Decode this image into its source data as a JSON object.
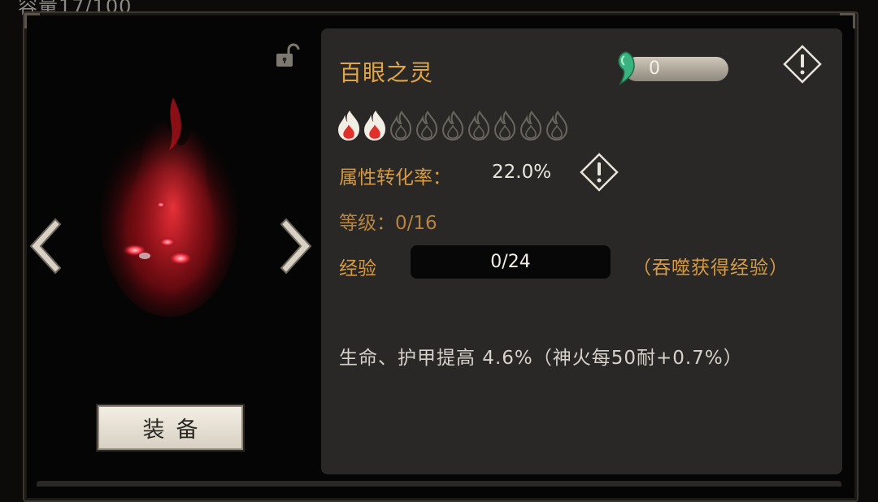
{
  "header": {
    "capacity_text": "容量17/100"
  },
  "item": {
    "name": "百眼之灵",
    "currency_value": "0",
    "flames": {
      "lit": 2,
      "total": 9
    },
    "conversion_label": "属性转化率：",
    "conversion_value": "22.0%",
    "level_text": "等级：0/16",
    "exp_label": "经验",
    "exp_value": "0/24",
    "exp_progress": 0,
    "devour_hint": "（吞噬获得经验）",
    "description": "生命、护甲提高 4.6%（神火每50耐+0.7%）"
  },
  "actions": {
    "equip_label": "装备"
  },
  "colors": {
    "accent_gold": "#d49a47",
    "panel_bg": "#2a2826",
    "soul_green": "#3fb884"
  },
  "icons": [
    "lock-open-icon",
    "soul-gem-icon",
    "info-diamond-icon",
    "flame-icon",
    "arrow-left-icon",
    "arrow-right-icon"
  ]
}
